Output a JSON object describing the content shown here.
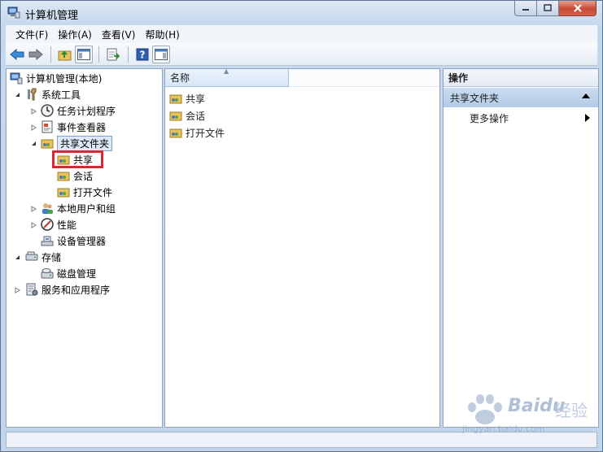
{
  "window": {
    "title": "计算机管理"
  },
  "menu": [
    {
      "label": "文件(F)"
    },
    {
      "label": "操作(A)"
    },
    {
      "label": "查看(V)"
    },
    {
      "label": "帮助(H)"
    }
  ],
  "tree": {
    "root": "计算机管理(本地)",
    "system_tools": "系统工具",
    "task_scheduler": "任务计划程序",
    "event_viewer": "事件查看器",
    "shared_folders": "共享文件夹",
    "shares": "共享",
    "sessions": "会话",
    "open_files": "打开文件",
    "local_users": "本地用户和组",
    "performance": "性能",
    "device_manager": "设备管理器",
    "storage": "存储",
    "disk_management": "磁盘管理",
    "services_apps": "服务和应用程序"
  },
  "list": {
    "column_name": "名称",
    "items": [
      "共享",
      "会话",
      "打开文件"
    ]
  },
  "actions": {
    "header": "操作",
    "section": "共享文件夹",
    "more": "更多操作"
  },
  "watermark": {
    "brand": "Baidu",
    "brand_cn": "经验",
    "url": "jingyan.baidu.com"
  },
  "colors": {
    "highlight_box": "#d62a33",
    "section_bg": "#b3cbe6"
  }
}
